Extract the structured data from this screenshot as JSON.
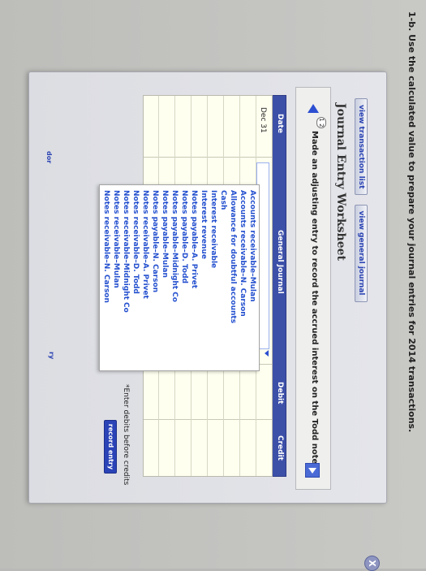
{
  "instruction": "1-b. Use the calculated value to prepare your journal entries for 2014 transactions.",
  "tabs": [
    "view transaction list",
    "view general journal"
  ],
  "close_label": "X",
  "worksheet_title": "Journal Entry Worksheet",
  "step_indicator": "1 2",
  "task_text": "Made an adjusting entry to record the accrued interest on the Todd note.",
  "grid": {
    "headers": {
      "date": "Date",
      "general_journal": "General Journal",
      "debit": "Debit",
      "credit": "Credit"
    },
    "date_value": "Dec 31"
  },
  "dropdown_options": [
    "Accounts receivable–Mulan",
    "Accounts receivable–N. Carson",
    "Allowance for doubtful accounts",
    "Cash",
    "Interest receivable",
    "Interest revenue",
    "Notes payable–A. Privet",
    "Notes payable–D. Todd",
    "Notes payable–Midnight Co",
    "Notes payable–Mulan",
    "Notes payable–N. Carson",
    "Notes receivable–A. Privet",
    "Notes receivable–D. Todd",
    "Notes receivable–Midnight Co",
    "Notes receivable–Mulan",
    "Notes receivable–N. Carson"
  ],
  "note": "*Enter debits before credits",
  "record_button": "record entry",
  "bottom_fragments": {
    "left": "dor",
    "right": "ry"
  },
  "colors": {
    "accent": "#2c4fd1",
    "header": "#3d50a8",
    "button": "#2a43b7"
  }
}
